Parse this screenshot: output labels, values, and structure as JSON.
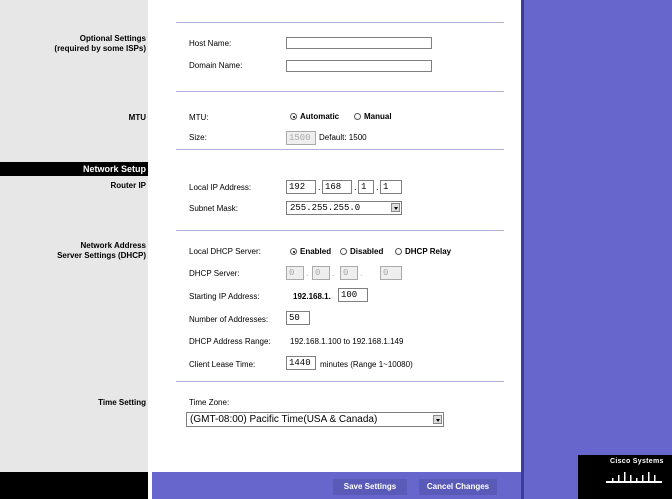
{
  "sections": {
    "optional": {
      "line1": "Optional Settings",
      "line2": "(required by some ISPs)"
    },
    "mtu": "MTU",
    "network_setup": "Network Setup",
    "router_ip": "Router IP",
    "dhcp": {
      "line1": "Network Address",
      "line2": "Server Settings (DHCP)"
    },
    "time": "Time Setting"
  },
  "optional": {
    "host_name_label": "Host Name:",
    "host_name_value": "",
    "domain_name_label": "Domain Name:",
    "domain_name_value": ""
  },
  "mtu": {
    "mtu_label": "MTU:",
    "automatic": "Automatic",
    "manual": "Manual",
    "selected": "Automatic",
    "size_label": "Size:",
    "size_value": "1500",
    "default_text": "Default: 1500"
  },
  "router_ip": {
    "local_ip_label": "Local IP Address:",
    "local_ip": [
      "192",
      "168",
      "1",
      "1"
    ],
    "subnet_label": "Subnet Mask:",
    "subnet_value": "255.255.255.0"
  },
  "dhcp": {
    "server_label": "Local DHCP Server:",
    "enabled": "Enabled",
    "disabled": "Disabled",
    "relay": "DHCP Relay",
    "selected": "Enabled",
    "dhcp_server_label": "DHCP Server:",
    "dhcp_server": [
      "0",
      "0",
      "0",
      "0"
    ],
    "start_label": "Starting IP Address:",
    "start_prefix": "192.168.1.",
    "start_value": "100",
    "num_label": "Number of Addresses:",
    "num_value": "50",
    "range_label": "DHCP Address Range:",
    "range_value": "192.168.1.100 to 192.168.1.149",
    "lease_label": "Client Lease Time:",
    "lease_value": "1440",
    "lease_suffix": "minutes (Range 1~10080)"
  },
  "time": {
    "zone_label": "Time Zone:",
    "zone_value": "(GMT-08:00) Pacific Time(USA & Canada)"
  },
  "buttons": {
    "save": "Save Settings",
    "cancel": "Cancel Changes"
  },
  "logo": "Cisco Systems",
  "colors": {
    "accent": "#6666cc",
    "sidebar": "#e7e7e7",
    "bar": "#000000"
  }
}
